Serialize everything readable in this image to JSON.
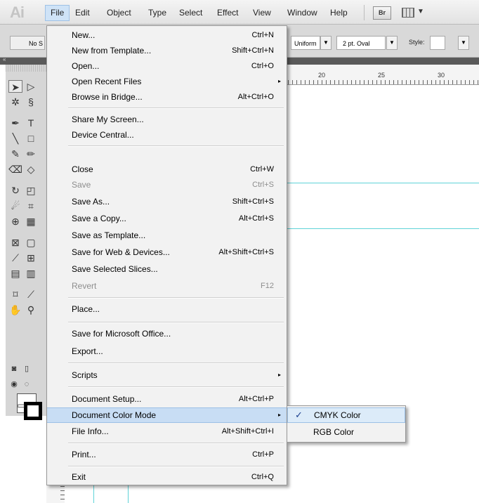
{
  "app": {
    "logo": "Ai"
  },
  "menubar": {
    "items": [
      "File",
      "Edit",
      "Object",
      "Type",
      "Select",
      "Effect",
      "View",
      "Window",
      "Help"
    ],
    "bridge_button": "Br"
  },
  "control_bar": {
    "selection": "No S",
    "profile": "Uniform",
    "brush": "2 pt. Oval",
    "style_label": "Style:"
  },
  "ruler": {
    "marks": [
      "20",
      "25",
      "30"
    ]
  },
  "file_menu": {
    "items": [
      {
        "label": "New...",
        "shortcut": "Ctrl+N"
      },
      {
        "label": "New from Template...",
        "shortcut": "Shift+Ctrl+N"
      },
      {
        "label": "Open...",
        "shortcut": "Ctrl+O"
      },
      {
        "label": "Open Recent Files",
        "submenu": "▸"
      },
      {
        "label": "Browse in Bridge...",
        "shortcut": "Alt+Ctrl+O"
      },
      {
        "label": "Share My Screen..."
      },
      {
        "label": "Device Central..."
      },
      {
        "label": "Close",
        "shortcut": "Ctrl+W"
      },
      {
        "label": "Save",
        "shortcut": "Ctrl+S",
        "disabled": true
      },
      {
        "label": "Save As...",
        "shortcut": "Shift+Ctrl+S"
      },
      {
        "label": "Save a Copy...",
        "shortcut": "Alt+Ctrl+S"
      },
      {
        "label": "Save as Template..."
      },
      {
        "label": "Save for Web & Devices...",
        "shortcut": "Alt+Shift+Ctrl+S"
      },
      {
        "label": "Save Selected Slices..."
      },
      {
        "label": "Revert",
        "shortcut": "F12",
        "disabled": true
      },
      {
        "label": "Place..."
      },
      {
        "label": "Save for Microsoft Office..."
      },
      {
        "label": "Export..."
      },
      {
        "label": "Scripts",
        "submenu": "▸"
      },
      {
        "label": "Document Setup...",
        "shortcut": "Alt+Ctrl+P"
      },
      {
        "label": "Document Color Mode",
        "submenu": "▸",
        "highlighted": true
      },
      {
        "label": "File Info...",
        "shortcut": "Alt+Shift+Ctrl+I"
      },
      {
        "label": "Print...",
        "shortcut": "Ctrl+P"
      },
      {
        "label": "Exit",
        "shortcut": "Ctrl+Q"
      }
    ]
  },
  "color_mode_submenu": {
    "items": [
      {
        "label": "CMYK Color",
        "checked": true,
        "check": "✓"
      },
      {
        "label": "RGB Color",
        "checked": false
      }
    ]
  }
}
